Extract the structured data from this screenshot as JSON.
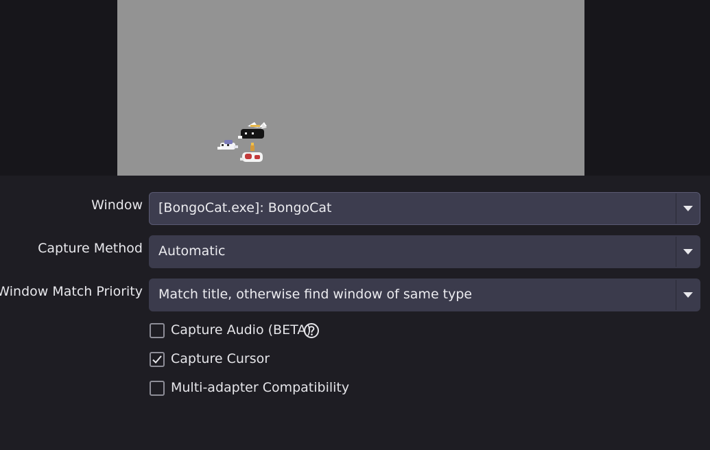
{
  "preview": {
    "background_color": "#939393",
    "content": "bongo-cat-sprites"
  },
  "fields": [
    {
      "label": "Window",
      "value": "[BongoCat.exe]: BongoCat"
    },
    {
      "label": "Capture Method",
      "value": "Automatic"
    },
    {
      "label": "Window Match Priority",
      "value": "Match title, otherwise find window of same type"
    }
  ],
  "checkboxes": [
    {
      "label": "Capture Audio (BETA)",
      "checked": false,
      "has_help_icon": true
    },
    {
      "label": "Capture Cursor",
      "checked": true,
      "has_help_icon": false
    },
    {
      "label": "Multi-adapter Compatibility",
      "checked": false,
      "has_help_icon": false
    }
  ],
  "icons": {
    "dropdown": "chevron-down-icon",
    "help": "help-circle-icon",
    "check": "checkmark-icon"
  }
}
